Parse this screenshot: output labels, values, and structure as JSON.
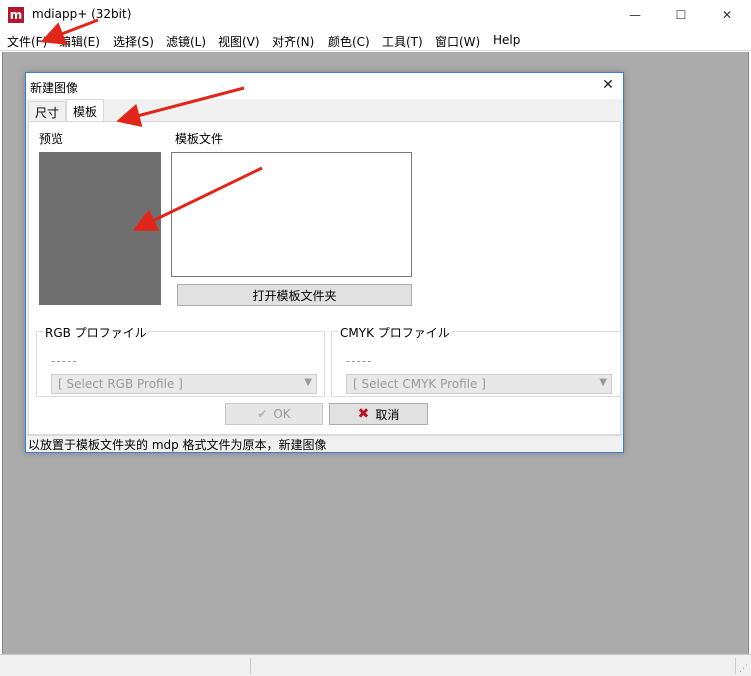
{
  "window": {
    "logo_letter": "m",
    "title": "mdiapp+ (32bit)",
    "minimize_glyph": "—",
    "maximize_glyph": "☐",
    "close_glyph": "✕"
  },
  "menu": {
    "items": [
      "文件(F)",
      "编辑(E)",
      "选择(S)",
      "滤镜(L)",
      "视图(V)",
      "对齐(N)",
      "颜色(C)",
      "工具(T)",
      "窗口(W)",
      "Help"
    ]
  },
  "dialog": {
    "title": "新建图像",
    "close_glyph": "✕",
    "tabs": [
      "尺寸",
      "模板"
    ],
    "preview_label": "预览",
    "template_files_label": "模板文件",
    "open_folder_button": "打开模板文件夹",
    "rgb_group_label": "RGB プロファイル",
    "rgb_dashes": "-----",
    "rgb_select_placeholder": "[ Select RGB Profile ]",
    "cmyk_group_label": "CMYK プロファイル",
    "cmyk_dashes": "-----",
    "cmyk_select_placeholder": "[ Select CMYK Profile ]",
    "ok_button": "OK",
    "cancel_button": "取消",
    "status_text": "以放置于模板文件夹的 mdp 格式文件为原本，新建图像"
  },
  "colors": {
    "brand": "#b5152b",
    "workspace": "#ababab",
    "annotation_arrow": "#e0261b"
  }
}
